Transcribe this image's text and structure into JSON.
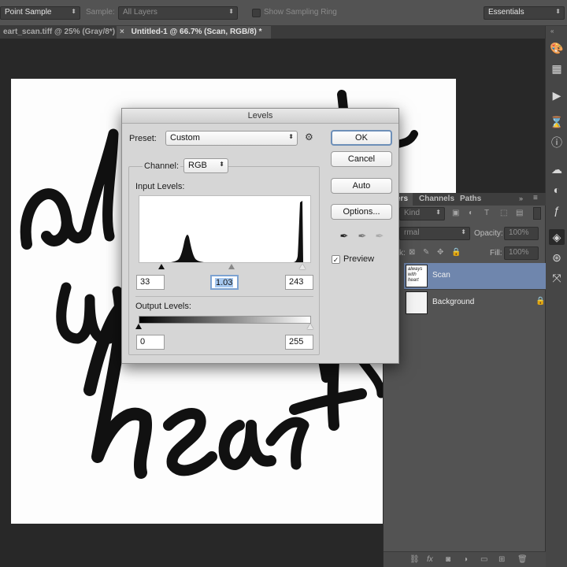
{
  "options_bar": {
    "sample_size_value": "Point Sample",
    "sample_label": "Sample:",
    "sample_value": "All Layers",
    "show_sampling_ring_label": "Show Sampling Ring",
    "workspace_value": "Essentials"
  },
  "tabs": [
    {
      "label": "eart_scan.tiff @ 25% (Gray/8*)"
    },
    {
      "label": "Untitled-1 @ 66.7% (Scan, RGB/8) *",
      "close": "×"
    }
  ],
  "canvas": {
    "artwork_words": [
      "always",
      "with",
      "heart"
    ]
  },
  "layers_panel": {
    "tabs": [
      "ers",
      "Channels",
      "Paths"
    ],
    "filter_value": "Kind",
    "blend_mode_value": "rmal",
    "opacity_label": "Opacity:",
    "opacity_value": "100%",
    "lock_label": "k:",
    "fill_label": "Fill:",
    "fill_value": "100%",
    "layers": [
      {
        "name": "Scan",
        "selected": true,
        "thumb_text": "always with heart"
      },
      {
        "name": "Background",
        "selected": false,
        "locked": true
      }
    ]
  },
  "levels_dialog": {
    "title": "Levels",
    "preset_label": "Preset:",
    "preset_value": "Custom",
    "channel_label": "Channel:",
    "channel_value": "RGB",
    "input_levels_label": "Input Levels:",
    "input_black": "33",
    "input_gamma": "1.03",
    "input_white": "243",
    "output_levels_label": "Output Levels:",
    "output_black": "0",
    "output_white": "255",
    "buttons": {
      "ok": "OK",
      "cancel": "Cancel",
      "auto": "Auto",
      "options": "Options..."
    },
    "preview_label": "Preview",
    "preview_checked": true
  },
  "histogram": {
    "channel": "RGB",
    "levels_range": [
      0,
      255
    ],
    "shape_note_hidden": false
  },
  "colors": {
    "selected_layer": "#6f86ad",
    "dialog_bg": "#d6d6d6",
    "default_button_ring": "#6d8fb8"
  }
}
